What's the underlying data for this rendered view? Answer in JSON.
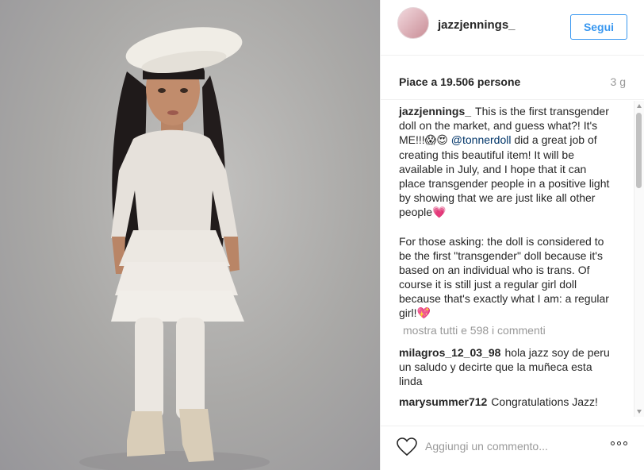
{
  "post": {
    "username": "jazzjennings_",
    "follow_label": "Segui",
    "likes": "Piace a 19.506 persone",
    "time_ago": "3 g",
    "caption": {
      "author": "jazzjennings_",
      "paragraph1_a": "This is the first transgender doll on the market, and guess what?! It's ME!!!",
      "paragraph1_emoji": "😱😍",
      "mention": "@tonnerdoll",
      "paragraph1_b": "did a great job of creating this beautiful item! It will be available in July, and I hope that it can place transgender people in a positive light by showing that we are just like all other people",
      "paragraph1_end_emoji": "💗",
      "paragraph2": "For those asking: the doll is considered to be the first \"transgender\" doll because it's based on an individual who is trans. Of course it is still just a regular girl doll because that's exactly what I am: a regular girl!",
      "paragraph2_end_emoji": "💖"
    },
    "view_all_comments": "mostra tutti e 598 i commenti",
    "comments": [
      {
        "author": "milagros_12_03_98",
        "text": "hola jazz soy de peru un saludo y decirte que la muñeca esta linda"
      },
      {
        "author": "marysummer712",
        "text": "Congratulations Jazz!"
      }
    ],
    "comment_placeholder": "Aggiungi un commento...",
    "icons": {
      "like": "heart-icon",
      "options": "more-options-icon"
    },
    "colors": {
      "accent": "#3897f0",
      "mention": "#003569",
      "muted": "#999999"
    }
  }
}
